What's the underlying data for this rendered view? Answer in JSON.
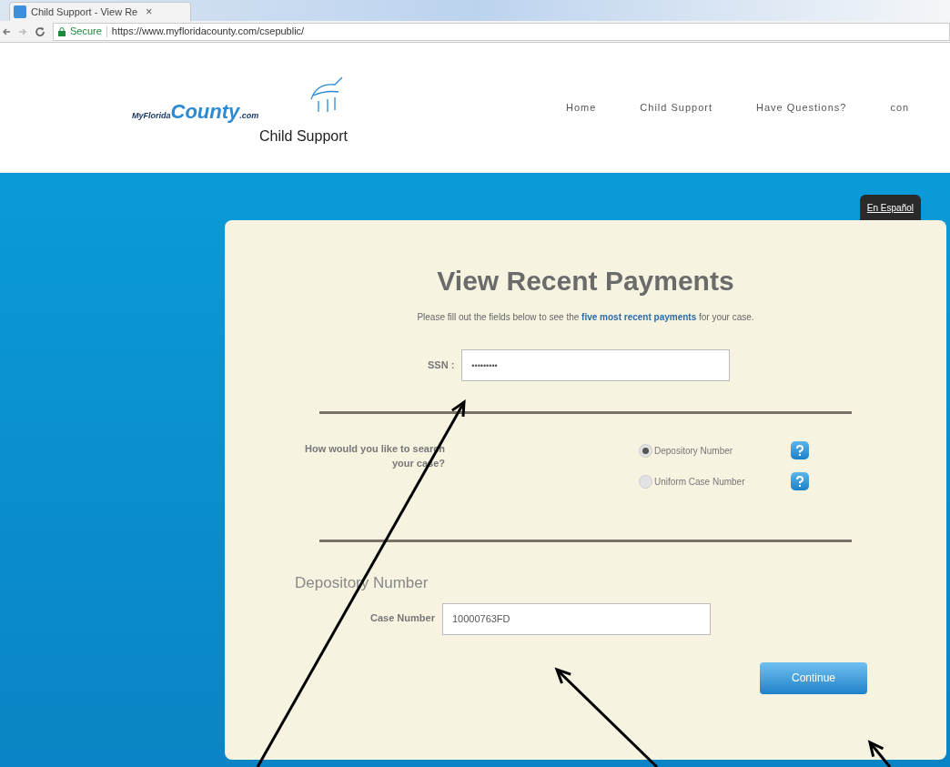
{
  "browser": {
    "tab_title": "Child Support - View Re",
    "tab_close": "×",
    "secure_label": "Secure",
    "url": "https://www.myfloridacounty.com/csepublic/"
  },
  "header": {
    "logo": {
      "prefix": "MyFlorida",
      "main": "County",
      "suffix": ".com",
      "subtitle": "Child Support"
    },
    "nav": [
      "Home",
      "Child Support",
      "Have Questions?",
      "con"
    ]
  },
  "language_link": "En Español",
  "form": {
    "title": "View Recent Payments",
    "intro": "Please fill out the fields below to see the **five most recent payments** for your case.",
    "ssn": {
      "label": "SSN :",
      "value": "•••••••••"
    },
    "search_question": "How would you like to search your case?",
    "search_options": [
      {
        "label": "Depository Number",
        "selected": true
      },
      {
        "label": "Uniform Case Number",
        "selected": false
      }
    ],
    "section_title": "Depository Number",
    "case_number": {
      "label": "Case Number",
      "value": "10000763FD"
    },
    "continue_button": "Continue"
  },
  "annotations": [
    {
      "kind": "arrow"
    },
    {
      "kind": "arrow"
    },
    {
      "kind": "arrow"
    }
  ]
}
